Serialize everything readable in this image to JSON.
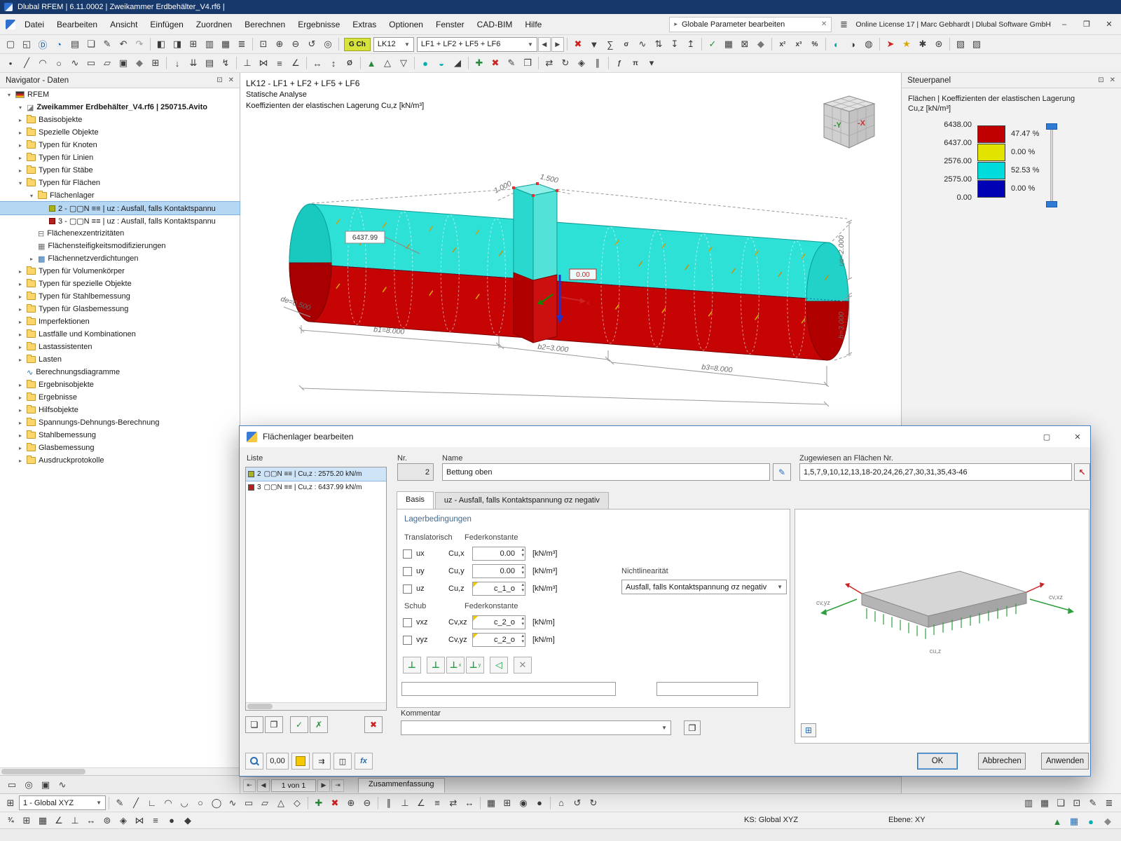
{
  "titlebar": {
    "title": "Dlubal RFEM | 6.11.0002 | Zweikammer Erdbehälter_V4.rf6 |"
  },
  "window": {
    "minimize": "–",
    "restore": "❐",
    "close": "✕"
  },
  "menubar": {
    "items": [
      "Datei",
      "Bearbeiten",
      "Ansicht",
      "Einfügen",
      "Zuordnen",
      "Berechnen",
      "Ergebnisse",
      "Extras",
      "Optionen",
      "Fenster",
      "CAD-BIM",
      "Hilfe"
    ],
    "search_value": "Globale Parameter bearbeiten",
    "license": "Online License 17 | Marc Gebhardt | Dlubal Software GmbH"
  },
  "toolbar1": {
    "gch": "G Ch",
    "lk": "LK12",
    "lf": "LF1 + LF2 + LF5 + LF6",
    "left": [
      {
        "n": "new-model-icon",
        "g": "▢"
      },
      {
        "n": "open-model-icon",
        "g": "◱"
      },
      {
        "n": "dlubal-center-icon",
        "g": "Ⓓ",
        "c": "#1b5fb5"
      },
      {
        "n": "model-sync-icon",
        "g": "◔",
        "c": "#1b5fb5"
      },
      {
        "n": "print-icon",
        "g": "▤"
      },
      {
        "n": "copy-icon",
        "g": "❏"
      },
      {
        "n": "edit-icon",
        "g": "✎"
      },
      {
        "n": "undo-icon",
        "g": "↶"
      },
      {
        "n": "redo-icon",
        "g": "↷",
        "c": "#9b9b9b"
      },
      {
        "sep": true
      },
      {
        "n": "window-left-icon",
        "g": "◧"
      },
      {
        "n": "window-right-icon",
        "g": "◨"
      },
      {
        "n": "window-grid-icon",
        "g": "⊞"
      },
      {
        "n": "table-icon",
        "g": "▥"
      },
      {
        "n": "spreadsheet-icon",
        "g": "▦"
      },
      {
        "n": "list-icon",
        "g": "≣"
      },
      {
        "sep": true
      },
      {
        "n": "zoom-window-icon",
        "g": "⊡"
      },
      {
        "n": "zoom-in-icon",
        "g": "⊕"
      },
      {
        "n": "zoom-out-icon",
        "g": "⊖"
      },
      {
        "n": "view-rotate-icon",
        "g": "↺"
      },
      {
        "n": "view-center-icon",
        "g": "◎"
      },
      {
        "sep": true
      }
    ],
    "right": [
      {
        "sep": true
      },
      {
        "n": "delete-results-icon",
        "g": "✖",
        "c": "#cc2222"
      },
      {
        "n": "filter-results-icon",
        "g": "▼"
      },
      {
        "n": "sum-results-icon",
        "g": "∑"
      },
      {
        "n": "stress-icon",
        "t": "σ"
      },
      {
        "n": "result-diagram-icon",
        "g": "∿"
      },
      {
        "n": "sort-icon",
        "g": "⇅"
      },
      {
        "n": "import-icon",
        "g": "↧"
      },
      {
        "n": "export-icon",
        "g": "↥"
      },
      {
        "sep": true
      },
      {
        "n": "check-icon",
        "g": "✓",
        "c": "#2a8a3c"
      },
      {
        "n": "mesh-icon",
        "g": "▦"
      },
      {
        "n": "mesh-delete-icon",
        "g": "⊠"
      },
      {
        "n": "solid-select-icon",
        "g": "◆",
        "c": "#777777"
      },
      {
        "sep": true
      },
      {
        "n": "superposition-icon",
        "t": "x²"
      },
      {
        "n": "combination-icon",
        "t": "x³"
      },
      {
        "n": "percent-icon",
        "t": "%"
      },
      {
        "sep": true
      },
      {
        "n": "render-shaded-icon",
        "g": "◐",
        "c": "#00a6a6"
      },
      {
        "n": "render-wire-icon",
        "g": "◑"
      },
      {
        "n": "render-texture-icon",
        "g": "◍"
      },
      {
        "sep": true
      },
      {
        "n": "marker-icon",
        "g": "➤",
        "c": "#cc2222"
      },
      {
        "n": "favorite-icon",
        "g": "★",
        "c": "#d9a800"
      },
      {
        "n": "snap-settings-icon",
        "g": "✱"
      },
      {
        "n": "settings-icon",
        "g": "⊛"
      },
      {
        "sep": true
      },
      {
        "n": "section-icon",
        "g": "▧"
      },
      {
        "n": "clipping-icon",
        "g": "▨"
      }
    ]
  },
  "toolbar2": {
    "icons": [
      {
        "n": "node-tool-icon",
        "g": "•"
      },
      {
        "n": "line-tool-icon",
        "g": "╱"
      },
      {
        "n": "arc-tool-icon",
        "g": "◠"
      },
      {
        "n": "circle-tool-icon",
        "g": "○"
      },
      {
        "n": "spline-tool-icon",
        "g": "∿"
      },
      {
        "n": "rectangle-tool-icon",
        "g": "▭"
      },
      {
        "n": "polygon-tool-icon",
        "g": "▱"
      },
      {
        "n": "surface-tool-icon",
        "g": "▣"
      },
      {
        "n": "solid-tool-icon",
        "g": "◆",
        "c": "#777777"
      },
      {
        "n": "opening-tool-icon",
        "g": "⊞"
      },
      {
        "sep": true
      },
      {
        "n": "nodal-load-icon",
        "g": "↓"
      },
      {
        "n": "line-load-icon",
        "g": "⇊"
      },
      {
        "n": "area-load-icon",
        "g": "▤"
      },
      {
        "n": "free-load-icon",
        "g": "↯"
      },
      {
        "sep": true
      },
      {
        "n": "support-tool-icon",
        "g": "⊥"
      },
      {
        "n": "hinge-tool-icon",
        "g": "⋈"
      },
      {
        "n": "constraint-tool-icon",
        "g": "≡"
      },
      {
        "n": "angle-tool-icon",
        "g": "∠"
      },
      {
        "sep": true
      },
      {
        "n": "dimension-h-icon",
        "g": "↔"
      },
      {
        "n": "dimension-v-icon",
        "g": "↕"
      },
      {
        "n": "diameter-icon",
        "t": "Ø"
      },
      {
        "sep": true
      },
      {
        "n": "mesh-refine-icon",
        "g": "▲",
        "c": "#2a8a3c"
      },
      {
        "n": "mesh-generate-icon",
        "g": "△"
      },
      {
        "n": "mesh-clear-icon",
        "g": "▽"
      },
      {
        "sep": true
      },
      {
        "n": "render-solid-icon",
        "g": "●",
        "c": "#00b0b0"
      },
      {
        "n": "render-transparent-icon",
        "g": "◒",
        "c": "#00b0b0"
      },
      {
        "n": "shadow-icon",
        "g": "◢"
      },
      {
        "sep": true
      },
      {
        "n": "add-object-icon",
        "g": "✚",
        "c": "#2a8a3c"
      },
      {
        "n": "delete-object-icon",
        "g": "✖",
        "c": "#cc2222"
      },
      {
        "n": "modify-object-icon",
        "g": "✎"
      },
      {
        "n": "duplicate-object-icon",
        "g": "❐"
      },
      {
        "sep": true
      },
      {
        "n": "move-tool-icon",
        "g": "⇄"
      },
      {
        "n": "rotate-tool-icon",
        "g": "↻"
      },
      {
        "n": "mirror-tool-icon",
        "g": "◈"
      },
      {
        "n": "offset-tool-icon",
        "g": "∥"
      },
      {
        "sep": true
      },
      {
        "n": "function-icon",
        "t": "ƒ"
      },
      {
        "n": "formula-icon",
        "t": "π"
      },
      {
        "n": "more-tools-icon",
        "g": "▾"
      }
    ]
  },
  "navigator": {
    "title": "Navigator - Daten",
    "root": "RFEM",
    "project": "Zweikammer Erdbehälter_V4.rf6 | 250715.Avito",
    "tree": [
      {
        "t": "Basisobjekte",
        "level": 1,
        "e": "c",
        "i": "folder"
      },
      {
        "t": "Spezielle Objekte",
        "level": 1,
        "e": "c",
        "i": "folder"
      },
      {
        "t": "Typen für Knoten",
        "level": 1,
        "e": "c",
        "i": "folder"
      },
      {
        "t": "Typen für Linien",
        "level": 1,
        "e": "c",
        "i": "folder"
      },
      {
        "t": "Typen für Stäbe",
        "level": 1,
        "e": "c",
        "i": "folder"
      },
      {
        "t": "Typen für Flächen",
        "level": 1,
        "e": "o",
        "i": "folder"
      },
      {
        "t": "Flächenlager",
        "level": 2,
        "e": "o",
        "i": "folder"
      },
      {
        "t": "2 - ▢▢N ≡≡ | uz : Ausfall, falls Kontaktspannu",
        "level": 3,
        "e": "",
        "i": "swatchOlive",
        "sel": true
      },
      {
        "t": "3 - ▢▢N ≡≡ | uz : Ausfall, falls Kontaktspannu",
        "level": 3,
        "e": "",
        "i": "swatchRed"
      },
      {
        "t": "Flächenexzentrizitäten",
        "level": 2,
        "e": "",
        "i": "ecc"
      },
      {
        "t": "Flächensteifigkeitsmodifizierungen",
        "level": 2,
        "e": "",
        "i": "grid"
      },
      {
        "t": "Flächennetzverdichtungen",
        "level": 2,
        "e": "c",
        "i": "mesh"
      },
      {
        "t": "Typen für Volumenkörper",
        "level": 1,
        "e": "c",
        "i": "folder"
      },
      {
        "t": "Typen für spezielle Objekte",
        "level": 1,
        "e": "c",
        "i": "folder"
      },
      {
        "t": "Typen für Stahlbemessung",
        "level": 1,
        "e": "c",
        "i": "folder"
      },
      {
        "t": "Typen für Glasbemessung",
        "level": 1,
        "e": "c",
        "i": "folder"
      },
      {
        "t": "Imperfektionen",
        "level": 1,
        "e": "c",
        "i": "folder"
      },
      {
        "t": "Lastfälle und Kombinationen",
        "level": 1,
        "e": "c",
        "i": "folder"
      },
      {
        "t": "Lastassistenten",
        "level": 1,
        "e": "c",
        "i": "folder"
      },
      {
        "t": "Lasten",
        "level": 1,
        "e": "c",
        "i": "folder"
      },
      {
        "t": "Berechnungsdiagramme",
        "level": 1,
        "e": "",
        "i": "chart"
      },
      {
        "t": "Ergebnisobjekte",
        "level": 1,
        "e": "c",
        "i": "folder"
      },
      {
        "t": "Ergebnisse",
        "level": 1,
        "e": "c",
        "i": "folder"
      },
      {
        "t": "Hilfsobjekte",
        "level": 1,
        "e": "c",
        "i": "folder"
      },
      {
        "t": "Spannungs-Dehnungs-Berechnung",
        "level": 1,
        "e": "c",
        "i": "folder"
      },
      {
        "t": "Stahlbemessung",
        "level": 1,
        "e": "c",
        "i": "folder"
      },
      {
        "t": "Glasbemessung",
        "level": 1,
        "e": "c",
        "i": "folder"
      },
      {
        "t": "Ausdruckprotokolle",
        "level": 1,
        "e": "c",
        "i": "folder"
      }
    ],
    "bottom_icons": [
      {
        "n": "display-settings-icon",
        "g": "▭"
      },
      {
        "n": "visibility-icon",
        "g": "◎"
      },
      {
        "n": "camera-icon",
        "g": "▣"
      },
      {
        "n": "diagram-icon",
        "g": "∿"
      }
    ]
  },
  "viewport": {
    "line1": "LK12 - LF1 + LF2 + LF5 + LF6",
    "line2": "Statische Analyse",
    "line3": "Koeffizienten der elastischen Lagerung Cu,z [kN/m³]",
    "max_label": "6437.99",
    "zero_label": "0.00",
    "axis_x": "x",
    "dims": {
      "d1": "1.000",
      "d2": "1.500",
      "de": "de=0.500",
      "b1": "b1=8.000",
      "b2": "b2=3.000",
      "b3": "b3=8.000",
      "ue": "ue=2.000",
      "h": "h=3.000"
    },
    "cube": {
      "neg_y": "-Y",
      "neg_x": "-X"
    }
  },
  "panel": {
    "title": "Steuerpanel",
    "subtitle1": "Flächen | Koeffizienten der elastischen Lagerung",
    "subtitle2": "Cu,z [kN/m³]",
    "scale_values": [
      "6438.00",
      "6437.00",
      "2576.00",
      "2575.00",
      "0.00"
    ],
    "scale_swatches": [
      {
        "color": "#c00000",
        "pct": "47.47 %"
      },
      {
        "color": "#e3e300",
        "pct": "0.00 %"
      },
      {
        "color": "#00dcdc",
        "pct": "52.53 %"
      },
      {
        "color": "#0000b4",
        "pct": "0.00 %"
      }
    ]
  },
  "dialog": {
    "title": "Flächenlager bearbeiten",
    "liste_label": "Liste",
    "list_items": [
      {
        "nr": "2",
        "swatch": "#a8b41e",
        "text": "▢▢N ≡≡ | Cu,z : 2575.20 kN/m",
        "selected": true
      },
      {
        "nr": "3",
        "swatch": "#b62020",
        "text": "▢▢N ≡≡ | Cu,z : 6437.99 kN/m",
        "selected": false
      }
    ],
    "list_tools": [
      {
        "n": "new-support-icon",
        "g": "❏"
      },
      {
        "n": "copy-support-icon",
        "g": "❐"
      },
      {
        "n": "select-all-icon",
        "g": "✓",
        "c": "#2a8a3c"
      },
      {
        "n": "invert-selection-icon",
        "g": "✗",
        "c": "#2a8a3c"
      }
    ],
    "nr_label": "Nr.",
    "nr_value": "2",
    "name_label": "Name",
    "name_value": "Bettung oben",
    "assigned_label": "Zugewiesen an Flächen Nr.",
    "assigned_value": "1,5,7,9,10,12,13,18-20,24,26,27,30,31,35,43-46",
    "tabs": [
      "Basis",
      "uz - Ausfall, falls Kontaktspannung σz negativ"
    ],
    "group_title": "Lagerbedingungen",
    "trans_label": "Translatorisch",
    "feder_label": "Federkonstante",
    "trans_rows": [
      {
        "check": "ux",
        "coef": "Cu,x",
        "value": "0.00",
        "unit": "[kN/m³]"
      },
      {
        "check": "uy",
        "coef": "Cu,y",
        "value": "0.00",
        "unit": "[kN/m³]"
      },
      {
        "check": "uz",
        "coef": "Cu,z",
        "value": "c_1_o",
        "unit": "[kN/m³]",
        "formula": true
      }
    ],
    "nl_label": "Nichtlinearität",
    "nl_value": "Ausfall, falls Kontaktspannung σz negativ",
    "schub_label": "Schub",
    "feder2_label": "Federkonstante",
    "schub_rows": [
      {
        "check": "vxz",
        "coef": "Cv,xz",
        "value": "c_2_o",
        "unit": "[kN/m]",
        "formula": true
      },
      {
        "check": "vyz",
        "coef": "Cv,yz",
        "value": "c_2_o",
        "unit": "[kN/m]",
        "formula": true
      }
    ],
    "support_icons": [
      {
        "n": "support-rigid-icon",
        "g": "⊥",
        "c": "#1f9e3e"
      },
      {
        "n": "support-spring-icon",
        "g": "⊥",
        "c": "#1f9e3e"
      },
      {
        "n": "support-x-icon",
        "g": "⊥",
        "sup": "x",
        "c": "#1f9e3e"
      },
      {
        "n": "support-y-icon",
        "g": "⊥",
        "sup": "y",
        "c": "#1f9e3e"
      },
      {
        "n": "support-roller-icon",
        "g": "◁",
        "c": "#1f9e3e"
      },
      {
        "n": "support-none-icon",
        "g": "✕",
        "c": "#8a8a8a"
      }
    ],
    "komm_label": "Kommentar",
    "preview": {
      "l1": "cu,z",
      "l2": "cv,xz",
      "l3": "cv,yz"
    },
    "footer": {
      "zoom": "0,00",
      "fx": "fx"
    },
    "buttons": {
      "ok": "OK",
      "cancel": "Abbrechen",
      "apply": "Anwenden"
    }
  },
  "statusbar": {
    "page_nav": "1 von 1",
    "summary_tab": "Zusammenfassung",
    "coord_combo": "1 - Global XYZ",
    "ks": "KS: Global XYZ",
    "ebene": "Ebene: XY"
  },
  "bottom_toolbar": {
    "iconsA": [
      {
        "n": "sketch-icon",
        "g": "✎"
      },
      {
        "n": "draw-line-icon",
        "g": "╱"
      },
      {
        "n": "draw-ortho-icon",
        "g": "∟"
      },
      {
        "n": "draw-arc-icon",
        "g": "◠"
      },
      {
        "n": "draw-arc2-icon",
        "g": "◡"
      },
      {
        "n": "draw-circle-icon",
        "g": "○"
      },
      {
        "n": "draw-ellipse-icon",
        "g": "◯"
      },
      {
        "n": "draw-spline-icon",
        "g": "∿"
      },
      {
        "n": "draw-rect-icon",
        "g": "▭"
      },
      {
        "n": "draw-parallelogram-icon",
        "g": "▱"
      },
      {
        "n": "draw-triangle-icon",
        "g": "△"
      },
      {
        "n": "draw-rhombus-icon",
        "g": "◇"
      },
      {
        "sep": true
      },
      {
        "n": "add-node-icon",
        "g": "✚",
        "c": "#2a8a3c"
      },
      {
        "n": "delete-node-icon",
        "g": "✖",
        "c": "#cc2222"
      },
      {
        "n": "merge-icon",
        "g": "⊕"
      },
      {
        "n": "split-icon",
        "g": "⊖"
      },
      {
        "sep": true
      },
      {
        "n": "parallel-icon",
        "g": "∥"
      },
      {
        "n": "perpendicular-icon",
        "g": "⊥"
      },
      {
        "n": "angle-snap-icon",
        "g": "∠"
      },
      {
        "n": "align-icon",
        "g": "≡"
      },
      {
        "n": "trim-icon",
        "g": "⇄"
      },
      {
        "n": "extend-icon",
        "g": "↔"
      },
      {
        "sep": true
      },
      {
        "n": "grid-icon",
        "g": "▦"
      },
      {
        "n": "snap-grid-icon",
        "g": "⊞"
      },
      {
        "n": "object-snap-icon",
        "g": "◉"
      },
      {
        "n": "point-snap-icon",
        "g": "●"
      },
      {
        "sep": true
      },
      {
        "n": "home-view-icon",
        "g": "⌂"
      },
      {
        "n": "undo-view-icon",
        "g": "↺"
      },
      {
        "n": "redo-view-icon",
        "g": "↻"
      }
    ],
    "iconsA_right": [
      {
        "n": "table-view-icon",
        "g": "▥"
      },
      {
        "n": "grid-view-icon",
        "g": "▦"
      },
      {
        "n": "copy-view-icon",
        "g": "❏"
      },
      {
        "n": "zoom-select-icon",
        "g": "⊡"
      },
      {
        "n": "annotate-icon",
        "g": "✎"
      },
      {
        "n": "layer-list-icon",
        "g": "≣"
      }
    ],
    "iconsB_left": [
      {
        "n": "snap-ratio-icon",
        "t": "¾"
      },
      {
        "n": "grid-toggle-icon",
        "g": "⊞"
      },
      {
        "n": "raster-toggle-icon",
        "g": "▦"
      },
      {
        "n": "polar-snap-icon",
        "g": "∠"
      },
      {
        "n": "ortho-snap-icon",
        "g": "⊥"
      },
      {
        "n": "track-snap-icon",
        "g": "↔"
      },
      {
        "n": "center-snap-icon",
        "g": "⊚"
      },
      {
        "n": "midpoint-snap-icon",
        "g": "◈"
      },
      {
        "n": "intersection-snap-icon",
        "g": "⋈"
      },
      {
        "n": "alignment-snap-icon",
        "g": "≡"
      },
      {
        "n": "node-snap-icon",
        "g": "●"
      },
      {
        "n": "edge-snap-icon",
        "g": "◆"
      }
    ],
    "iconsB_right": [
      {
        "n": "status-ok-icon",
        "g": "▲",
        "c": "#2a8a3c"
      },
      {
        "n": "mesh-status-icon",
        "g": "▦",
        "c": "#2a6fb5"
      },
      {
        "n": "render-status-icon",
        "g": "●",
        "c": "#00b0b0"
      },
      {
        "n": "info-status-icon",
        "g": "◆",
        "c": "#888888"
      }
    ]
  }
}
